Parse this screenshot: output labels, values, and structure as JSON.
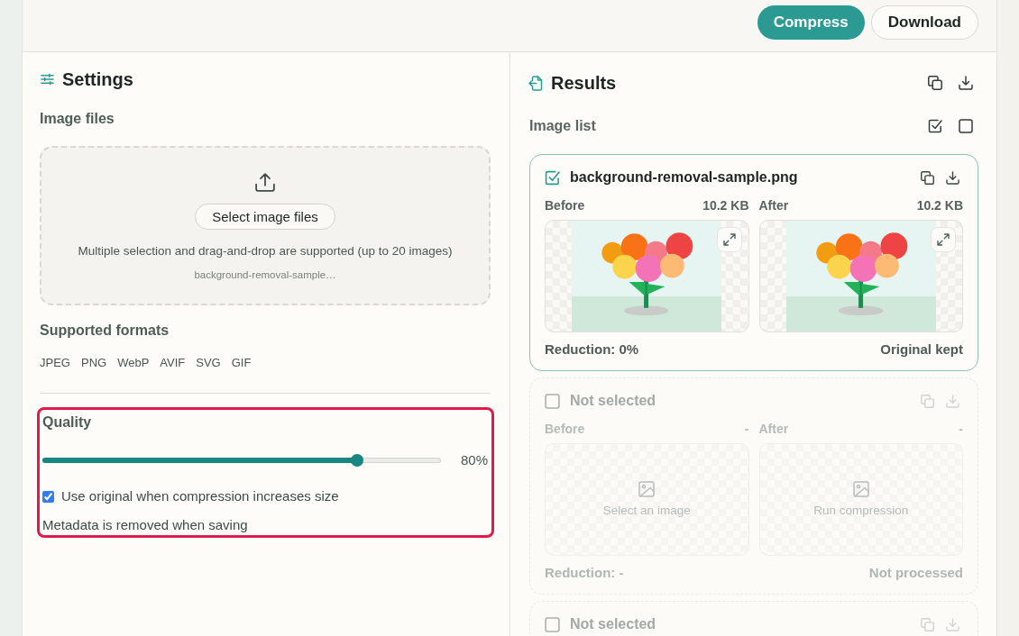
{
  "toolbar": {
    "buttons": [
      {
        "label": "Compress",
        "kind": "primary"
      },
      {
        "label": "Download",
        "kind": "secondary"
      }
    ]
  },
  "settings": {
    "title": "Settings",
    "image_files": {
      "label": "Image files",
      "button": "Select image files",
      "hint": "Multiple selection and drag-and-drop are supported (up to 20 images)",
      "file": "background-removal-sample…"
    },
    "formats": {
      "label": "Supported formats",
      "items": [
        "JPEG",
        "PNG",
        "WebP",
        "AVIF",
        "SVG",
        "GIF"
      ]
    },
    "quality": {
      "highlighted": true,
      "label": "Quality",
      "level": 0.8,
      "reading": "80%",
      "options": [
        {
          "label": "Use original when compression increases size",
          "checked": true
        }
      ],
      "note": "Metadata is removed when saving"
    }
  },
  "results": {
    "title": "Results",
    "list_label": "Image list",
    "images": [
      {
        "kind": "image",
        "selected": true,
        "name": "background-removal-sample.png",
        "before": {
          "label": "Before",
          "size": "10.2 KB"
        },
        "after": {
          "label": "After",
          "size": "10.2 KB"
        },
        "reduction": "Reduction: 0%",
        "status": "Original kept"
      },
      {
        "kind": "empty",
        "selected": false,
        "name": "Not selected",
        "before": {
          "label": "Before",
          "size": "-",
          "hint": "Select an image"
        },
        "after": {
          "label": "After",
          "size": "-",
          "hint": "Run compression"
        },
        "reduction": "Reduction: -",
        "status": "Not processed"
      },
      {
        "kind": "empty",
        "selected": false,
        "name": "Not selected"
      }
    ]
  }
}
